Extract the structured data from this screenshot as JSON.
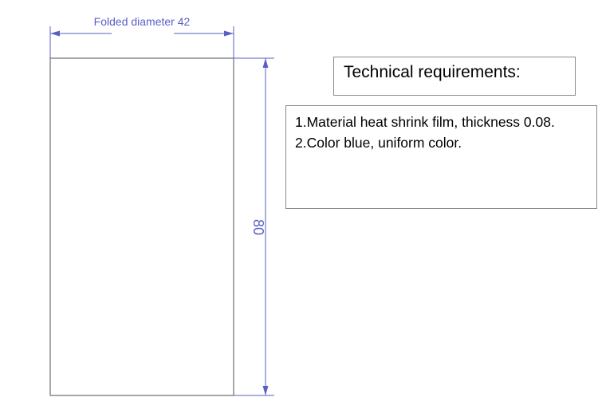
{
  "dimensions": {
    "width_label": "Folded diameter 42",
    "height_label": "80"
  },
  "colors": {
    "dimension": "#5a5fc4",
    "outline": "#8a8a8a"
  },
  "technical_requirements": {
    "title": "Technical requirements:",
    "items": [
      "1.Material heat shrink film, thickness 0.08.",
      "2.Color blue, uniform color."
    ]
  }
}
